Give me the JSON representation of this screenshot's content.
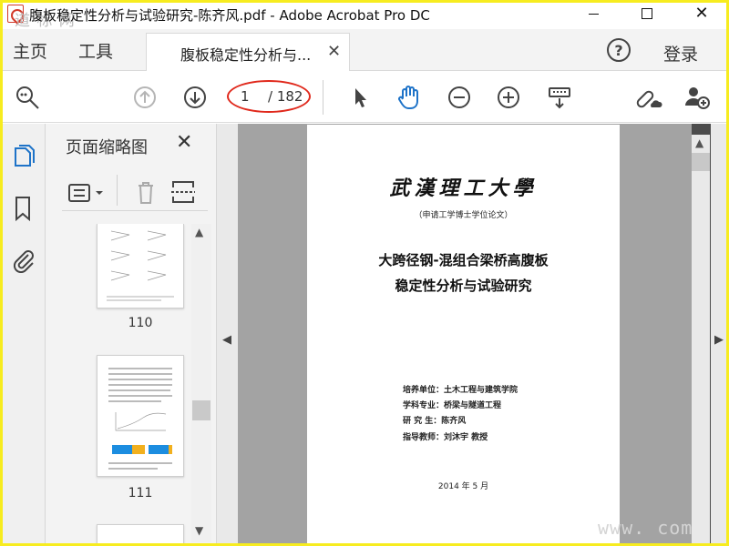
{
  "titlebar": {
    "title": "腹板稳定性分析与试验研究-陈齐风.pdf - Adobe Acrobat Pro DC",
    "watermark_left": "道 标 网"
  },
  "menu": {
    "home": "主页",
    "tools": "工具",
    "doc_tab": "腹板稳定性分析与...",
    "login": "登录"
  },
  "toolbar": {
    "current_page": "1",
    "total_pages": "/ 182",
    "accent_color": "#1e73c8",
    "annotation_color": "#e0291c"
  },
  "panel": {
    "title": "页面缩略图",
    "thumbnails": [
      {
        "label": "110"
      },
      {
        "label": "111"
      }
    ]
  },
  "document": {
    "university": "武漢理工大學",
    "applicant": "（申请工学博士学位论文）",
    "title_line1": "大跨径钢-混组合梁桥高腹板",
    "title_line2": "稳定性分析与试验研究",
    "info": [
      "培养单位：土木工程与建筑学院",
      "学科专业：桥梁与隧道工程",
      "研  究  生：陈齐风",
      "指导教师：刘沐宇  教授"
    ],
    "date": "2014  年  5 月"
  },
  "watermark_right": "www.        com"
}
